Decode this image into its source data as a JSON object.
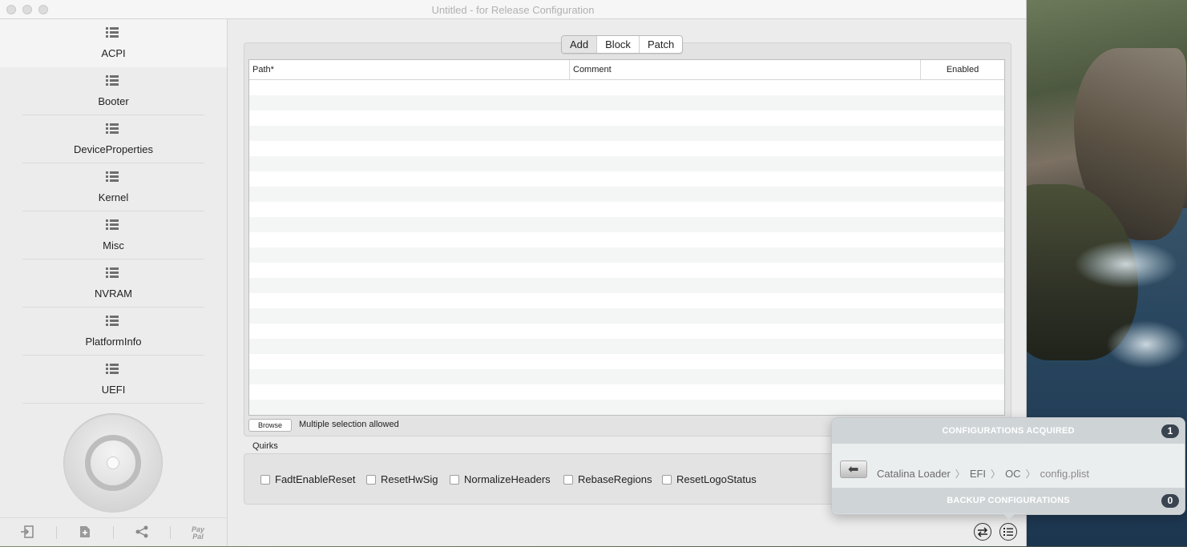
{
  "window": {
    "title": "Untitled - for Release Configuration"
  },
  "sidebar": {
    "items": [
      {
        "label": "ACPI",
        "active": true
      },
      {
        "label": "Booter"
      },
      {
        "label": "DeviceProperties"
      },
      {
        "label": "Kernel"
      },
      {
        "label": "Misc"
      },
      {
        "label": "NVRAM"
      },
      {
        "label": "PlatformInfo"
      },
      {
        "label": "UEFI"
      }
    ],
    "bottom_buttons": {
      "import_icon": "import-icon",
      "add_icon": "add-file-icon",
      "share_icon": "share-icon",
      "paypal_top": "Pay",
      "paypal_bottom": "Pal"
    }
  },
  "main": {
    "tabs": [
      {
        "label": "Add",
        "active": true
      },
      {
        "label": "Block"
      },
      {
        "label": "Patch"
      }
    ],
    "table": {
      "columns": [
        "Path*",
        "Comment",
        "Enabled"
      ],
      "rows": []
    },
    "browse": {
      "button_label": "Browse",
      "hint": "Multiple selection allowed"
    },
    "quirks": {
      "label": "Quirks",
      "items": [
        {
          "label": "FadtEnableReset",
          "checked": false
        },
        {
          "label": "ResetHwSig",
          "checked": false
        },
        {
          "label": "NormalizeHeaders",
          "checked": false
        },
        {
          "label": "RebaseRegions",
          "checked": false
        },
        {
          "label": "ResetLogoStatus",
          "checked": false
        }
      ]
    }
  },
  "popover": {
    "acquired_title": "CONFIGURATIONS ACQUIRED",
    "acquired_count": "1",
    "path": [
      "Catalina Loader",
      "EFI",
      "OC",
      "config.plist"
    ],
    "backup_title": "BACKUP CONFIGURATIONS",
    "backup_count": "0"
  }
}
